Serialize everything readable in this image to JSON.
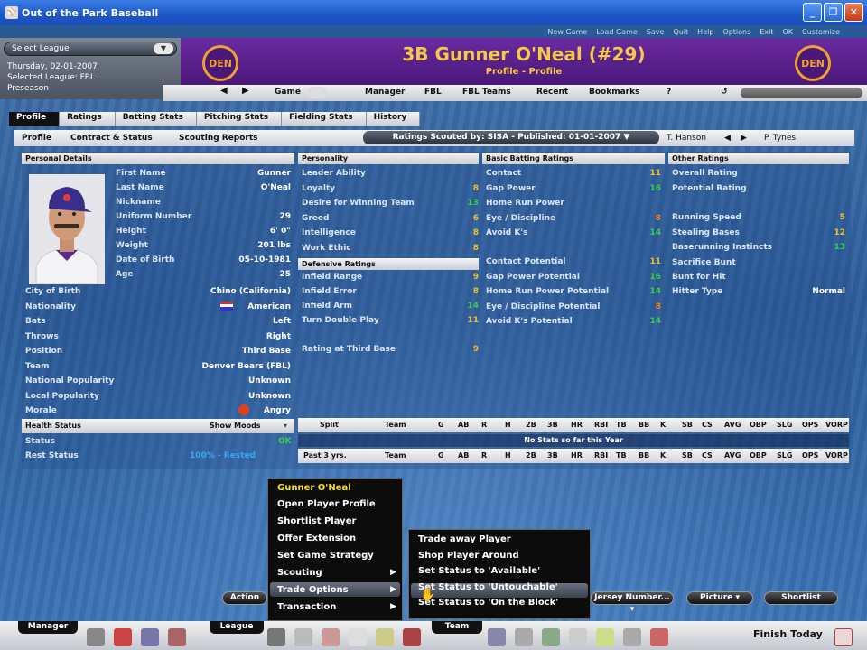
{
  "window": {
    "title": "Out of the Park Baseball",
    "top_links": [
      "New Game",
      "Load Game",
      "Save",
      "Quit",
      "Help",
      "Options",
      "Exit",
      "OK",
      "Customize"
    ]
  },
  "league": {
    "select_label": "Select League",
    "date": "Thursday, 02-01-2007",
    "selected": "Selected League: FBL",
    "phase": "Preseason"
  },
  "header": {
    "title": "3B Gunner O'Neal (#29)",
    "subtitle": "Profile - Profile",
    "team_abbr": "DEN"
  },
  "nav": {
    "game": "Game",
    "manager": "Manager",
    "fbl": "FBL",
    "fbl_teams": "FBL Teams",
    "recent": "Recent",
    "bookmarks": "Bookmarks",
    "help": "?"
  },
  "tabs": [
    "Profile",
    "Ratings",
    "Batting Stats",
    "Pitching Stats",
    "Fielding Stats",
    "History"
  ],
  "subtabs": {
    "profile": "Profile",
    "contract": "Contract & Status",
    "scouting": "Scouting Reports",
    "scout_select": "Ratings Scouted by: SISA - Published: 01-01-2007",
    "prev_player": "T. Hanson",
    "next_player": "P. Tynes"
  },
  "personal": {
    "header": "Personal Details",
    "rows": [
      {
        "label": "First Name",
        "value": "Gunner"
      },
      {
        "label": "Last Name",
        "value": "O'Neal"
      },
      {
        "label": "Nickname",
        "value": ""
      },
      {
        "label": "Uniform Number",
        "value": "29"
      },
      {
        "label": "Height",
        "value": "6' 0\""
      },
      {
        "label": "Weight",
        "value": "201 lbs"
      },
      {
        "label": "Date of Birth",
        "value": "05-10-1981"
      },
      {
        "label": "Age",
        "value": "25"
      }
    ],
    "wide_rows": [
      {
        "label": "City of Birth",
        "value": "Chino (California)"
      },
      {
        "label": "Nationality",
        "value": "American"
      },
      {
        "label": "Bats",
        "value": "Left"
      },
      {
        "label": "Throws",
        "value": "Right"
      },
      {
        "label": "Position",
        "value": "Third Base"
      },
      {
        "label": "Team",
        "value": "Denver Bears (FBL)"
      },
      {
        "label": "National Popularity",
        "value": "Unknown"
      },
      {
        "label": "Local Popularity",
        "value": "Unknown"
      },
      {
        "label": "Morale",
        "value": "Angry"
      }
    ]
  },
  "personality": {
    "header": "Personality",
    "rows": [
      {
        "label": "Leader Ability",
        "value": "",
        "color": "#38d048"
      },
      {
        "label": "Loyalty",
        "value": "8",
        "color": "#f0c020"
      },
      {
        "label": "Desire for Winning Team",
        "value": "13",
        "color": "#38d048"
      },
      {
        "label": "Greed",
        "value": "6",
        "color": "#f0c020"
      },
      {
        "label": "Intelligence",
        "value": "8",
        "color": "#f0c020"
      },
      {
        "label": "Work Ethic",
        "value": "8",
        "color": "#f0c020"
      }
    ]
  },
  "defensive": {
    "header": "Defensive Ratings",
    "rows": [
      {
        "label": "Infield Range",
        "value": "9",
        "color": "#f0c020"
      },
      {
        "label": "Infield Error",
        "value": "8",
        "color": "#f0c020"
      },
      {
        "label": "Infield Arm",
        "value": "14",
        "color": "#38d048"
      },
      {
        "label": "Turn Double Play",
        "value": "11",
        "color": "#f0c020"
      }
    ],
    "position_rating": {
      "label": "Rating at Third Base",
      "value": "9",
      "color": "#f0c020"
    }
  },
  "batting": {
    "header": "Basic Batting Ratings",
    "rows": [
      {
        "label": "Contact",
        "value": "11",
        "color": "#f0c020"
      },
      {
        "label": "Gap Power",
        "value": "16",
        "color": "#38d048"
      },
      {
        "label": "Home Run Power",
        "value": "",
        "color": "#38d048"
      },
      {
        "label": "Eye / Discipline",
        "value": "8",
        "color": "#f08020"
      },
      {
        "label": "Avoid K's",
        "value": "14",
        "color": "#38d048"
      }
    ],
    "potential": [
      {
        "label": "Contact Potential",
        "value": "11",
        "color": "#f0c020"
      },
      {
        "label": "Gap Power Potential",
        "value": "16",
        "color": "#38d048"
      },
      {
        "label": "Home Run Power Potential",
        "value": "14",
        "color": "#38d048"
      },
      {
        "label": "Eye / Discipline Potential",
        "value": "8",
        "color": "#f08020"
      },
      {
        "label": "Avoid K's Potential",
        "value": "14",
        "color": "#38d048"
      }
    ]
  },
  "other": {
    "header": "Other Ratings",
    "rows": [
      {
        "label": "Overall Rating",
        "value": ""
      },
      {
        "label": "Potential Rating",
        "value": ""
      }
    ],
    "running": [
      {
        "label": "Running Speed",
        "value": "5",
        "color": "#f0c020"
      },
      {
        "label": "Stealing Bases",
        "value": "12",
        "color": "#f0c020"
      },
      {
        "label": "Baserunning Instincts",
        "value": "13",
        "color": "#38d048"
      },
      {
        "label": "Sacrifice Bunt",
        "value": "",
        "color": "#e03030"
      },
      {
        "label": "Bunt for Hit",
        "value": "",
        "color": "#e03030"
      }
    ],
    "hitter_type": {
      "label": "Hitter Type",
      "value": "Normal"
    }
  },
  "health": {
    "header": "Health Status",
    "show_moods": "Show Moods",
    "status_label": "Status",
    "status_value": "OK",
    "rest_label": "Rest Status",
    "rest_value": "100% - Rested"
  },
  "stats": {
    "columns": [
      "G",
      "AB",
      "R",
      "H",
      "2B",
      "3B",
      "HR",
      "RBI",
      "TB",
      "BB",
      "K",
      "SB",
      "CS",
      "AVG",
      "OBP",
      "SLG",
      "OPS",
      "VORP"
    ],
    "split_label": "Split",
    "team_label": "Team",
    "no_stats": "No Stats so far this Year",
    "past_label": "Past 3 yrs.",
    "past_team_label": "Team"
  },
  "buttons": {
    "action": "Action",
    "jersey": "Jersey Number...",
    "picture": "Picture",
    "shortlist": "Shortlist"
  },
  "context_menu": {
    "title": "Gunner O'Neal",
    "items": [
      {
        "label": "Open Player Profile",
        "submenu": false
      },
      {
        "label": "Shortlist Player",
        "submenu": false
      },
      {
        "label": "Offer Extension",
        "submenu": false
      },
      {
        "label": "Set Game Strategy",
        "submenu": false
      },
      {
        "label": "Scouting",
        "submenu": true
      },
      {
        "label": "Trade Options",
        "submenu": true
      },
      {
        "label": "Transaction",
        "submenu": true
      }
    ]
  },
  "submenu": {
    "items": [
      "Trade away Player",
      "Shop Player Around",
      "Set Status to 'Available'",
      "Set Status to 'Untouchable'",
      "Set Status to 'On the Block'"
    ]
  },
  "taskbar": {
    "manager": "Manager",
    "league": "League",
    "team": "Team",
    "finish": "Finish Today"
  }
}
